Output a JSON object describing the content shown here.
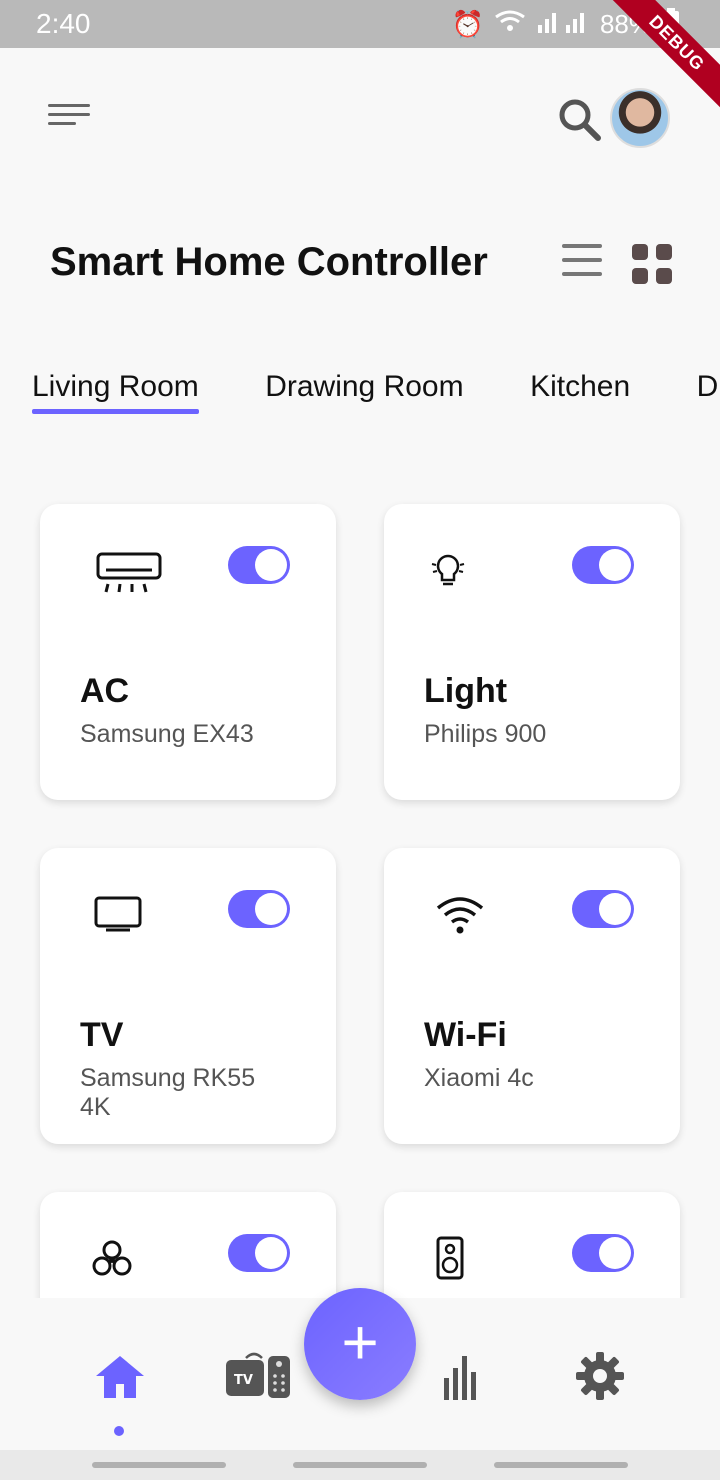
{
  "status_bar": {
    "time": "2:40",
    "battery": "88%",
    "debug_label": "DEBUG"
  },
  "header": {
    "title": "Smart Home Controller",
    "accent_color": "#6c63ff"
  },
  "tabs": [
    {
      "label": "Living Room",
      "active": true
    },
    {
      "label": "Drawing Room",
      "active": false
    },
    {
      "label": "Kitchen",
      "active": false
    },
    {
      "label": "D",
      "active": false
    }
  ],
  "devices": [
    {
      "name": "AC",
      "model": "Samsung EX43",
      "icon": "air-conditioner-icon",
      "on": true
    },
    {
      "name": "Light",
      "model": "Philips 900",
      "icon": "light-bulb-icon",
      "on": true
    },
    {
      "name": "TV",
      "model": "Samsung RK55 4K",
      "icon": "tv-icon",
      "on": true
    },
    {
      "name": "Wi-Fi",
      "model": "Xiaomi 4c",
      "icon": "wifi-icon",
      "on": true
    },
    {
      "name": "",
      "model": "",
      "icon": "fan-icon",
      "on": true
    },
    {
      "name": "",
      "model": "",
      "icon": "speaker-icon",
      "on": true
    }
  ],
  "bottom_nav": {
    "items": [
      "home-icon",
      "tv-remote-icon",
      "add-icon",
      "stats-icon",
      "settings-icon"
    ],
    "active": "home-icon",
    "fab_symbol": "+"
  }
}
